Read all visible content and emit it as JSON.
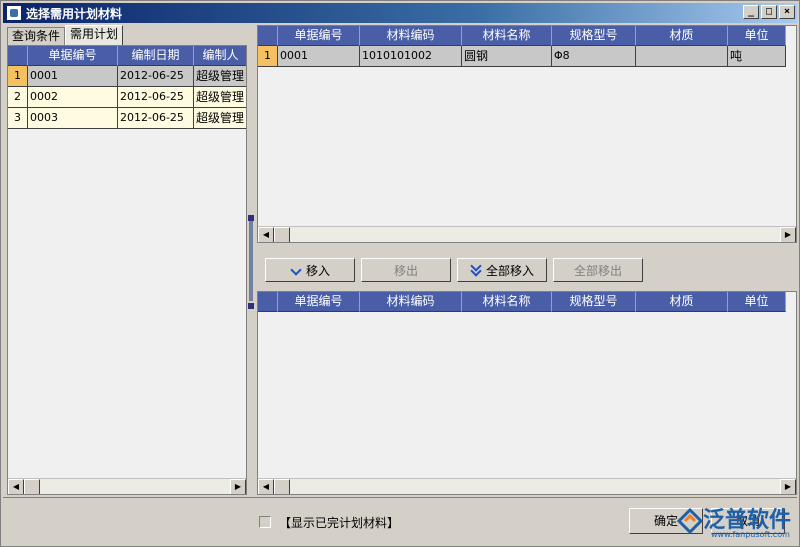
{
  "window": {
    "title": "选择需用计划材料",
    "min_glyph": "_",
    "max_glyph": "□",
    "close_glyph": "×"
  },
  "left": {
    "tabs": [
      {
        "label": "查询条件",
        "active": false
      },
      {
        "label": "需用计划",
        "active": true
      }
    ],
    "columns": [
      "单据编号",
      "编制日期",
      "编制人"
    ],
    "rows": [
      {
        "n": "1",
        "doc_no": "0001",
        "date": "2012-06-25",
        "creator": "超级管理"
      },
      {
        "n": "2",
        "doc_no": "0002",
        "date": "2012-06-25",
        "creator": "超级管理"
      },
      {
        "n": "3",
        "doc_no": "0003",
        "date": "2012-06-25",
        "creator": "超级管理"
      }
    ]
  },
  "right_top": {
    "columns": [
      "单据编号",
      "材料编码",
      "材料名称",
      "规格型号",
      "材质",
      "单位"
    ],
    "rows": [
      {
        "n": "1",
        "doc_no": "0001",
        "code": "1010101002",
        "name": "圆钢",
        "spec": "Φ8",
        "material": "",
        "unit": "吨"
      }
    ]
  },
  "buttons": {
    "move_in": "移入",
    "move_out": "移出",
    "move_all_in": "全部移入",
    "move_all_out": "全部移出"
  },
  "right_bottom": {
    "columns": [
      "单据编号",
      "材料编码",
      "材料名称",
      "规格型号",
      "材质",
      "单位"
    ]
  },
  "footer": {
    "show_completed_label": "【显示已完计划材料】",
    "ok_label": "确定",
    "cancel_label": "取消",
    "logo_text": "泛普软件",
    "logo_url": "www.fanpusoft.com"
  },
  "colors": {
    "header_bg": "#4a5ea8",
    "row_bg": "#fffbe0",
    "selected_rownum": "#f4c060",
    "brand": "#1f5fa8"
  }
}
